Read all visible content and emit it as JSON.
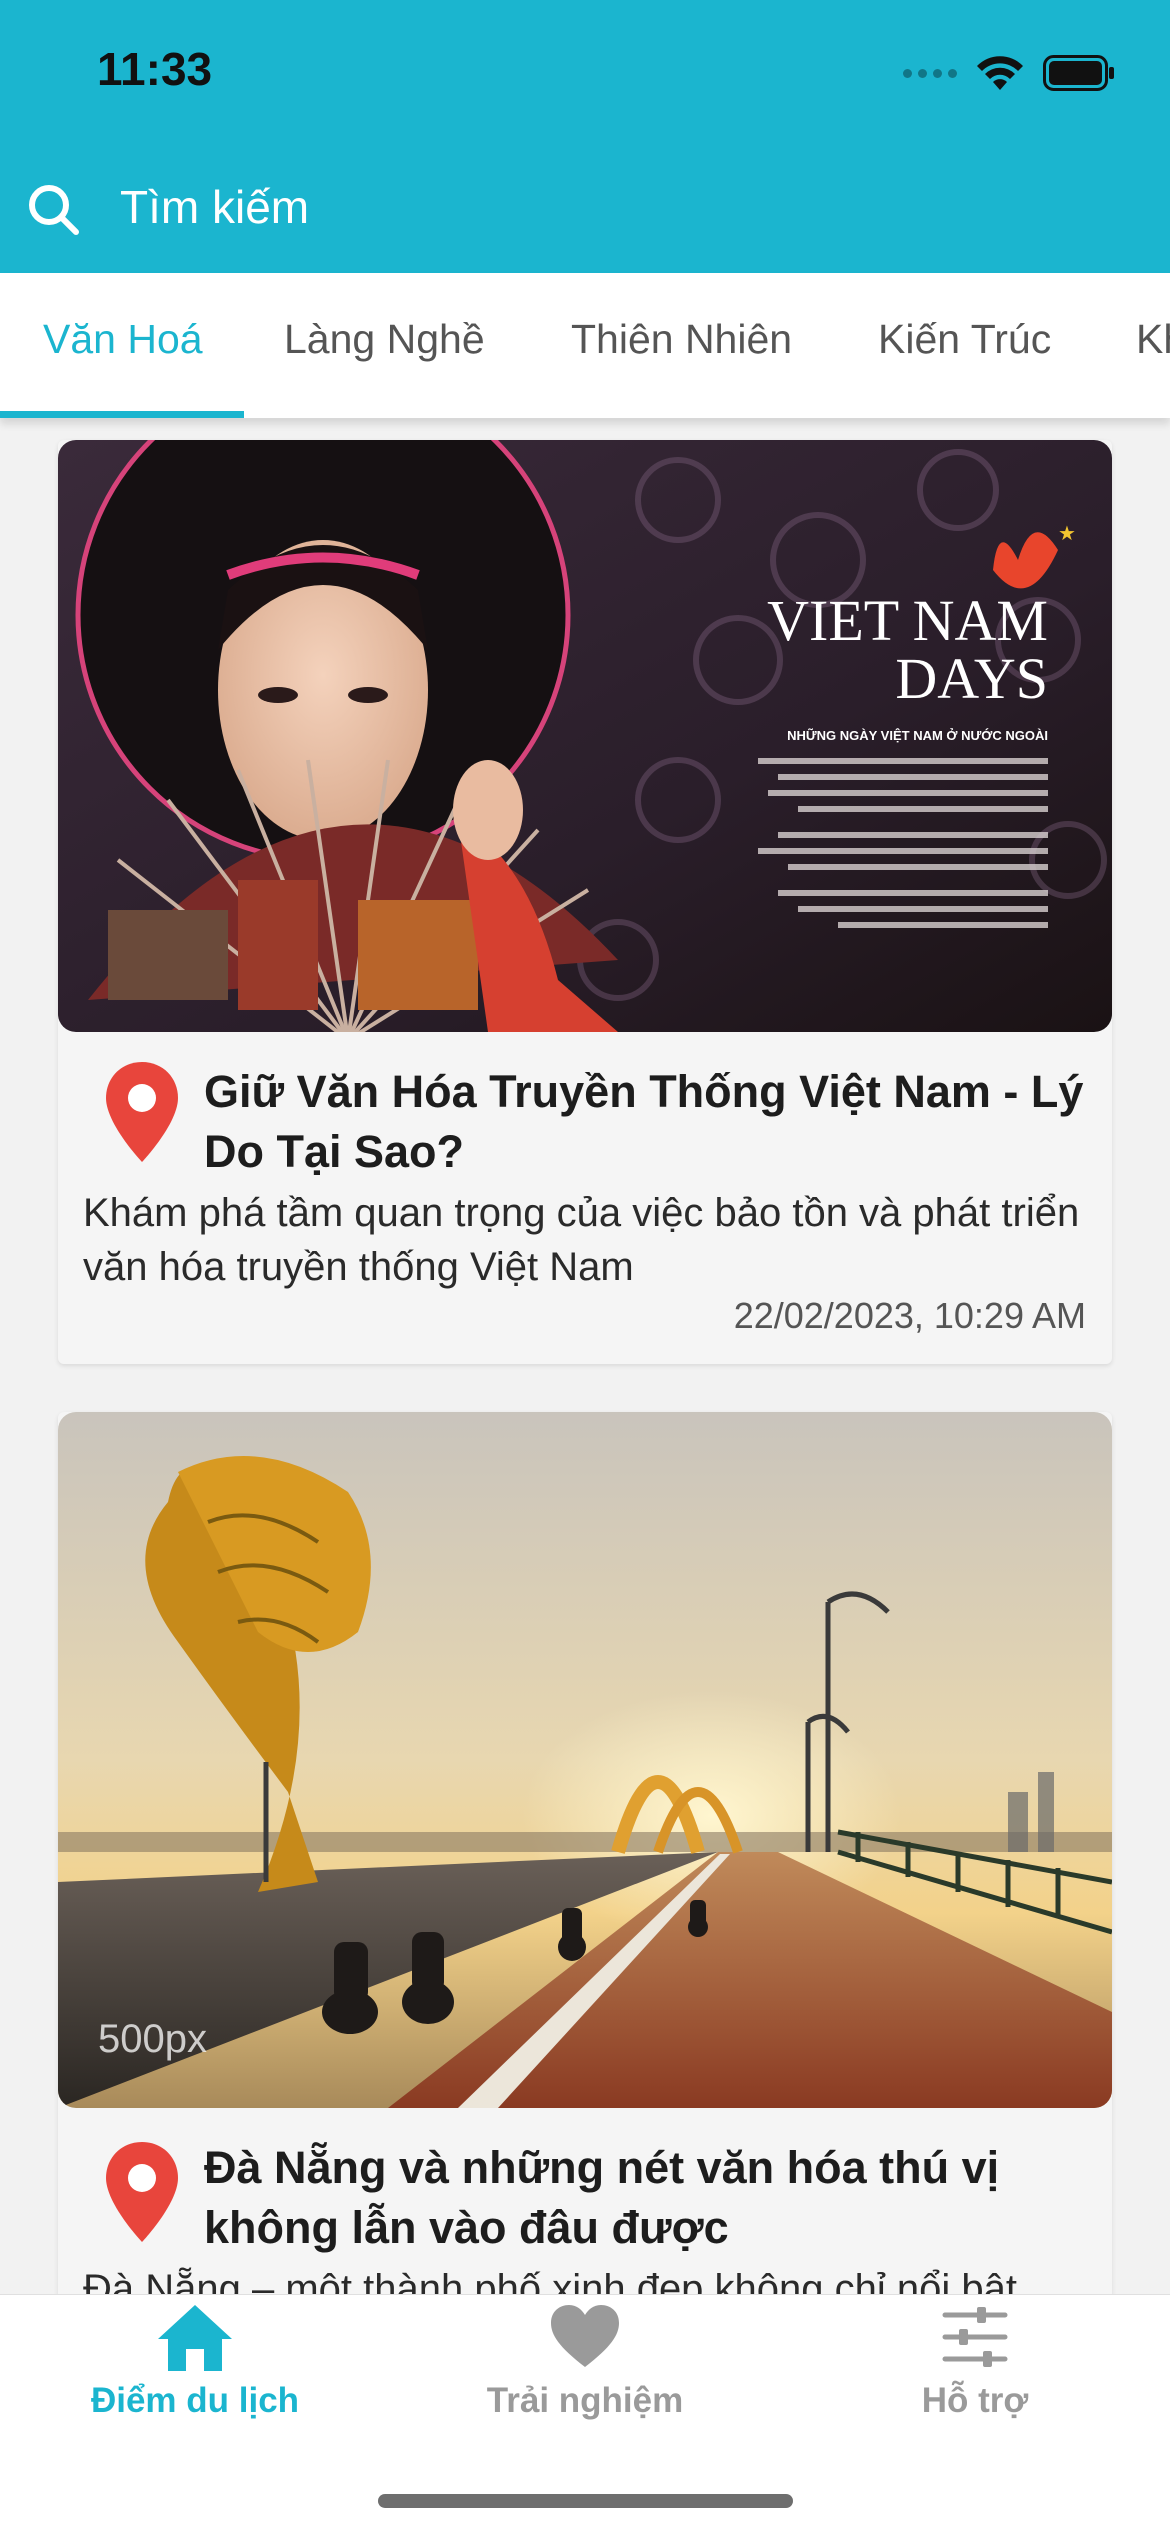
{
  "status_bar": {
    "time": "11:33"
  },
  "search": {
    "placeholder": "Tìm kiếm",
    "value": ""
  },
  "tabs": [
    {
      "label": "Văn Hoá",
      "active": true
    },
    {
      "label": "Làng Nghề",
      "active": false
    },
    {
      "label": "Thiên Nhiên",
      "active": false
    },
    {
      "label": "Kiến Trúc",
      "active": false
    },
    {
      "label": "Kh",
      "active": false
    }
  ],
  "articles": [
    {
      "image_text": {
        "title_line1": "VIET NAM",
        "title_line2": "DAYS",
        "subtitle": "NHỮNG NGÀY VIỆT NAM Ở NƯỚC NGOÀI"
      },
      "title": "Giữ Văn Hóa Truyền Thống Việt Nam - Lý Do Tại Sao?",
      "description": "Khám phá tầm quan trọng của việc bảo tồn và phát triển văn hóa truyền thống Việt Nam",
      "date": "22/02/2023, 10:29 AM"
    },
    {
      "image_text": {
        "watermark": "500px"
      },
      "title": "Đà Nẵng và những nét văn hóa thú vị không lẫn vào đâu được",
      "description": "Đà Nẵng – một thành phố xinh đẹp không chỉ nổi bật"
    }
  ],
  "bottom_nav": [
    {
      "label": "Điểm du lịch",
      "icon": "home-icon",
      "active": true
    },
    {
      "label": "Trải nghiệm",
      "icon": "heart-icon",
      "active": false
    },
    {
      "label": "Hỗ trợ",
      "icon": "sliders-icon",
      "active": false
    }
  ],
  "colors": {
    "primary": "#1bb5cf",
    "pin": "#e8453c",
    "inactive": "#9a9a9a"
  }
}
